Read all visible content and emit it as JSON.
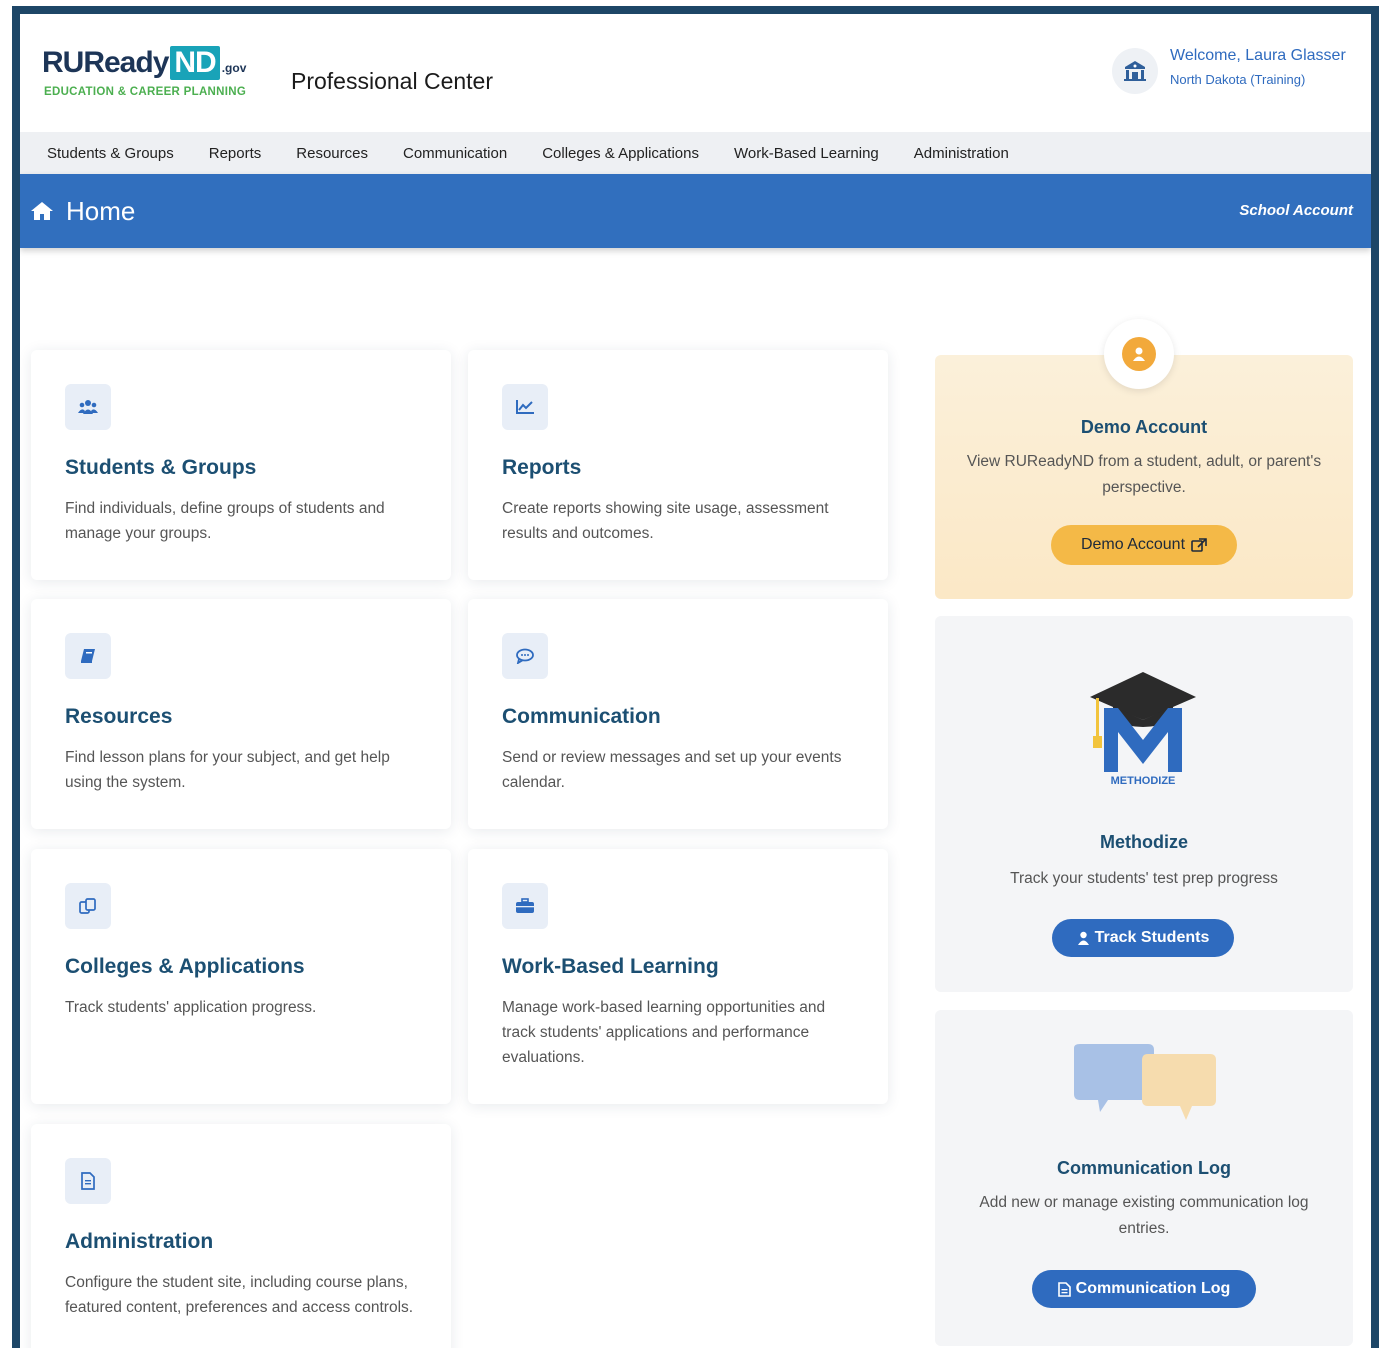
{
  "header": {
    "logo_main": "RUReady",
    "logo_nd": "ND",
    "logo_gov": ".gov",
    "logo_sub": "EDUCATION & CAREER PLANNING",
    "center_title": "Professional Center",
    "welcome": "Welcome, Laura Glasser",
    "region": "North Dakota (Training)"
  },
  "nav": {
    "items": [
      {
        "label": "Students & Groups"
      },
      {
        "label": "Reports"
      },
      {
        "label": "Resources"
      },
      {
        "label": "Communication"
      },
      {
        "label": "Colleges & Applications"
      },
      {
        "label": "Work-Based Learning"
      },
      {
        "label": "Administration"
      }
    ]
  },
  "homebar": {
    "title": "Home",
    "account_type": "School Account"
  },
  "cards": [
    {
      "icon": "users-icon",
      "title": "Students & Groups",
      "desc": "Find individuals, define groups of students and manage your groups."
    },
    {
      "icon": "chart-line-icon",
      "title": "Reports",
      "desc": "Create reports showing site usage, assessment results and outcomes."
    },
    {
      "icon": "book-icon",
      "title": "Resources",
      "desc": "Find lesson plans for your subject, and get help using the system."
    },
    {
      "icon": "comment-icon",
      "title": "Communication",
      "desc": "Send or review messages and set up your events calendar."
    },
    {
      "icon": "copy-icon",
      "title": "Colleges & Applications",
      "desc": "Track students' application progress."
    },
    {
      "icon": "briefcase-icon",
      "title": "Work-Based Learning",
      "desc": "Manage work-based learning opportunities and track students' applications and performance evaluations."
    },
    {
      "icon": "file-icon",
      "title": "Administration",
      "desc": "Configure the student site, including course plans, featured content, preferences and access controls."
    }
  ],
  "demo": {
    "title": "Demo Account",
    "desc": "View RUReadyND from a student, adult, or parent's perspective.",
    "button": "Demo Account"
  },
  "methodize": {
    "logo_text": "METHODIZE",
    "title": "Methodize",
    "desc": "Track your students' test prep progress",
    "button": "Track Students"
  },
  "commlog": {
    "title": "Communication Log",
    "desc": "Add new or manage existing communication log entries.",
    "button": "Communication Log"
  },
  "colors": {
    "frame": "#1d4667",
    "primary": "#316fbe",
    "title": "#1c4f72",
    "demo_button": "#f4b947",
    "logo_teal": "#19a3b8",
    "logo_green": "#4caf50"
  }
}
